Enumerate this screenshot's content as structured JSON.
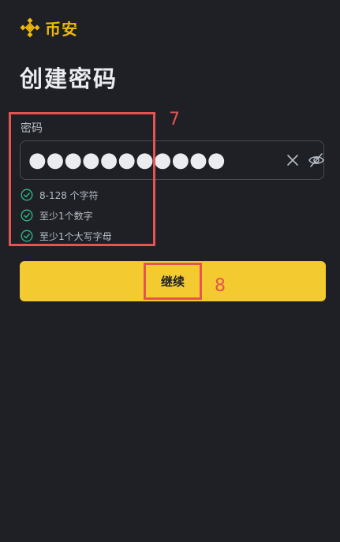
{
  "brand": {
    "name": "币安",
    "color": "#f0b90b"
  },
  "page": {
    "title": "创建密码"
  },
  "password": {
    "label": "密码",
    "masked_value": "●●●●●●●●●●●",
    "clear_icon": "close-icon",
    "visibility_icon": "eye-off-icon"
  },
  "rules": [
    {
      "text": "8-128 个字符",
      "status": "satisfied"
    },
    {
      "text": "至少1个数字",
      "status": "satisfied"
    },
    {
      "text": "至少1个大写字母",
      "status": "satisfied"
    }
  ],
  "rule_check_color": "#2ebd85",
  "continue_button": {
    "label": "继续",
    "color": "#f3cb30"
  },
  "annotations": [
    {
      "number": "7",
      "target": "password-section"
    },
    {
      "number": "8",
      "target": "continue-button"
    }
  ],
  "annotation_color": "#e55353"
}
